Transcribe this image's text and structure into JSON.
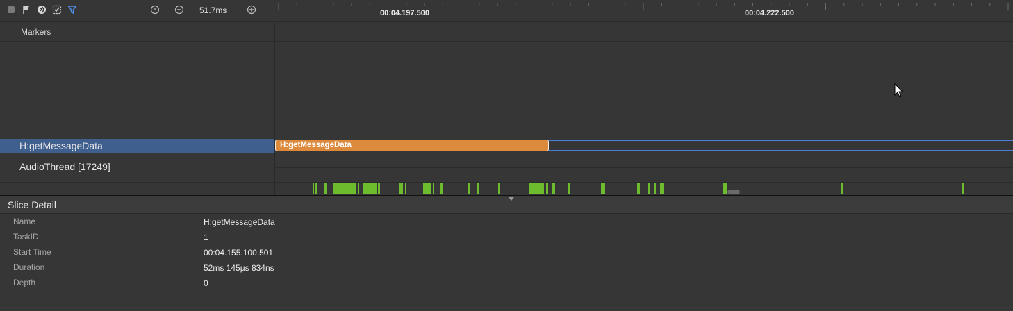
{
  "toolbar": {
    "icons": [
      "stop-icon",
      "flag-icon",
      "globe-icon",
      "check-list-icon",
      "filter-icon",
      "reset-zoom-icon",
      "zoom-out-icon",
      "zoom-in-icon"
    ],
    "zoom_readout": "51.7ms"
  },
  "ruler": {
    "ticks": [
      "00:04.197.500",
      "00:04.222.500"
    ]
  },
  "tracks": {
    "markers_label": "Markers",
    "selected_function_label": "H:getMessageData",
    "thread_label": "AudioThread [17249]"
  },
  "slice": {
    "label": "H:getMessageData",
    "color": "#dd8a3c",
    "selection_color": "#4a7fd4"
  },
  "cpu_activity_color": "#6cbc2e",
  "detail": {
    "title": "Slice Detail",
    "rows": [
      {
        "key": "Name",
        "value": "H:getMessageData"
      },
      {
        "key": "TaskID",
        "value": "1"
      },
      {
        "key": "Start Time",
        "value": "00:04.155.100.501"
      },
      {
        "key": "Duration",
        "value": "52ms 145μs 834ns"
      },
      {
        "key": "Depth",
        "value": "0"
      }
    ]
  }
}
